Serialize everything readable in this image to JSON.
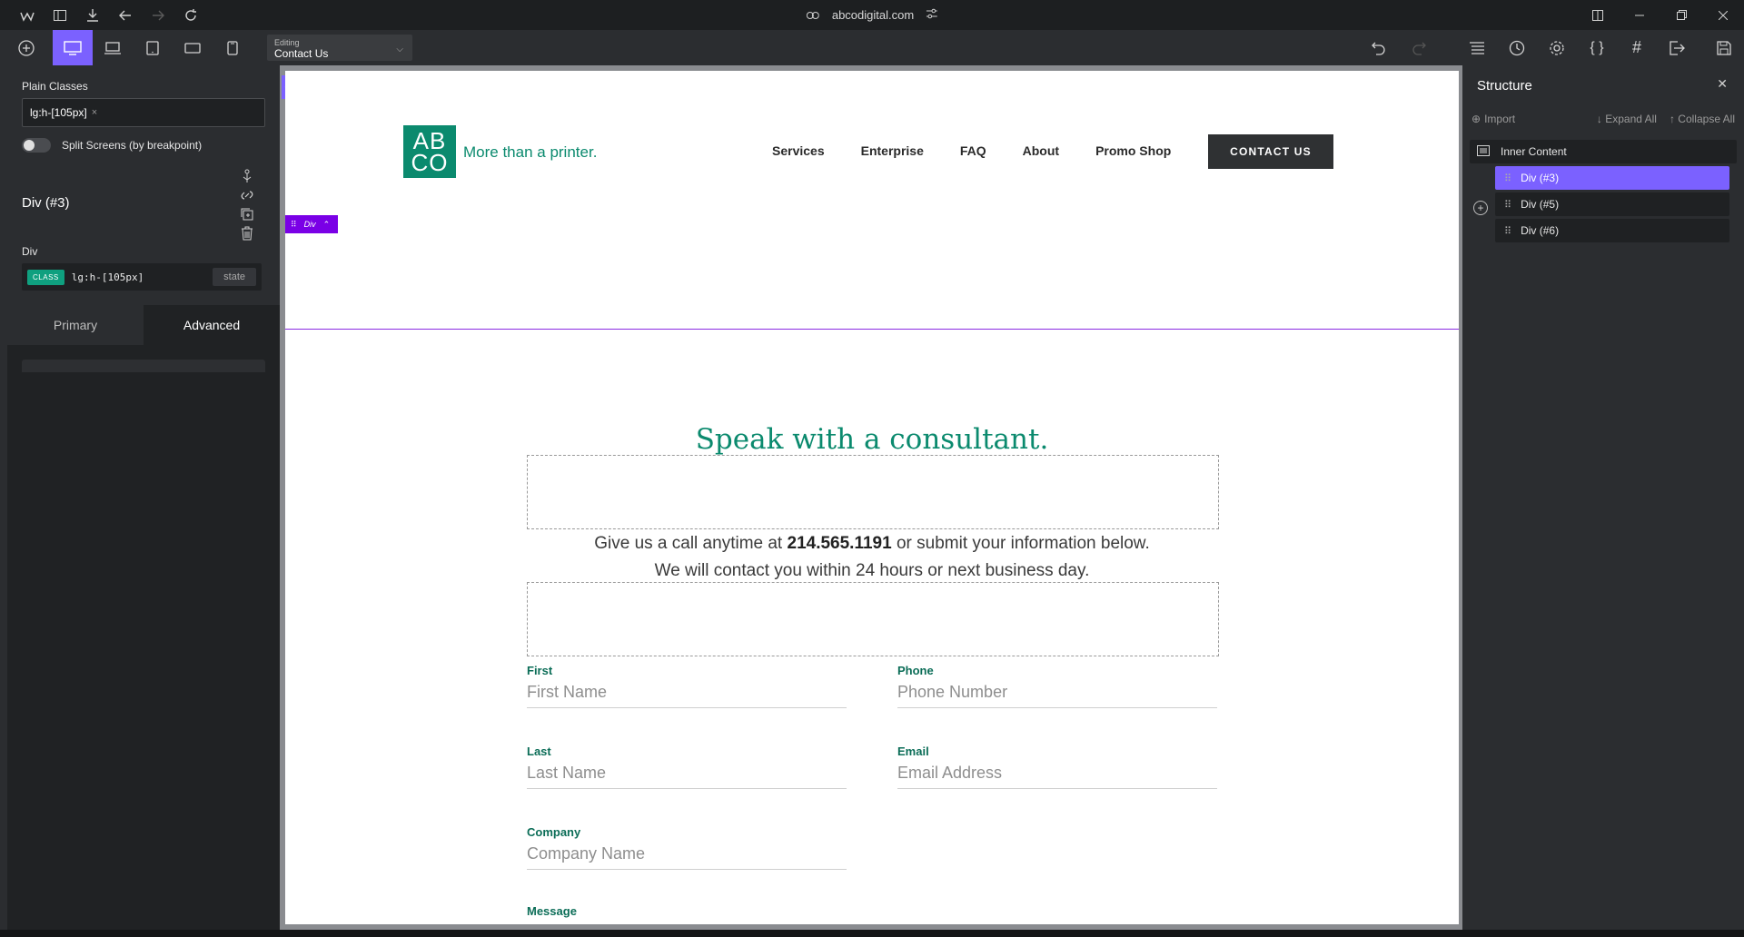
{
  "browser": {
    "url": "abcodigital.com"
  },
  "toolbar": {
    "editing_label": "Editing",
    "editing_page": "Contact Us"
  },
  "left_panel": {
    "plain_classes_label": "Plain Classes",
    "plain_class_value": "lg:h-[105px]",
    "remove_glyph": "×",
    "split_screens_label": "Split Screens (by breakpoint)",
    "element_title": "Div (#3)",
    "element_type": "Div",
    "class_chip": "CLASS",
    "class_name": "lg:h-[105px]",
    "state_label": "state",
    "tabs": [
      {
        "label": "Primary",
        "active": false
      },
      {
        "label": "Advanced",
        "active": true
      }
    ]
  },
  "canvas": {
    "logo_text_top": "AB",
    "logo_text_bottom": "CO",
    "tagline": "More than a printer.",
    "nav": [
      "Services",
      "Enterprise",
      "FAQ",
      "About",
      "Promo Shop"
    ],
    "contact_button": "CONTACT US",
    "selected_badge": "Div",
    "heading": "Speak with a consultant.",
    "subtitle_line1_pre": "Give us a call anytime at ",
    "phone": "214.565.1191",
    "subtitle_line1_post": " or submit your information below.",
    "subtitle_line2": "We will contact you within 24 hours or next business day.",
    "form": {
      "first_label": "First",
      "first_placeholder": "First Name",
      "phone_label": "Phone",
      "phone_placeholder": "Phone Number",
      "last_label": "Last",
      "last_placeholder": "Last Name",
      "email_label": "Email",
      "email_placeholder": "Email Address",
      "company_label": "Company",
      "company_placeholder": "Company Name",
      "message_label": "Message"
    }
  },
  "structure": {
    "title": "Structure",
    "import_label": "Import",
    "expand_all": "Expand All",
    "collapse_all": "Collapse All",
    "root": "Inner Content",
    "children": [
      {
        "label": "Div (#3)",
        "selected": true
      },
      {
        "label": "Div (#5)",
        "selected": false
      },
      {
        "label": "Div (#6)",
        "selected": false
      }
    ]
  },
  "colors": {
    "accent": "#7b61ff",
    "brand_green": "#0b8a6e",
    "selection_purple": "#7a00e6"
  }
}
